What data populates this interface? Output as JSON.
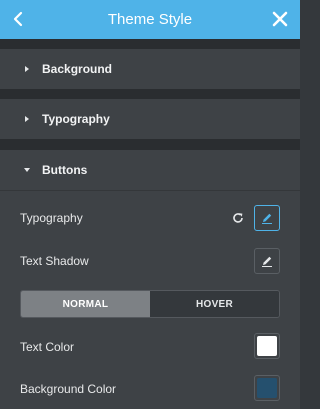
{
  "header": {
    "title": "Theme Style",
    "color": "#4fb3e8"
  },
  "sections": [
    {
      "label": "Background",
      "expanded": false
    },
    {
      "label": "Typography",
      "expanded": false
    },
    {
      "label": "Buttons",
      "expanded": true
    }
  ],
  "buttons_panel": {
    "typography_label": "Typography",
    "text_shadow_label": "Text Shadow",
    "tabs": [
      {
        "label": "NORMAL",
        "active": true
      },
      {
        "label": "HOVER",
        "active": false
      }
    ],
    "text_color_label": "Text Color",
    "text_color_value": "#ffffff",
    "background_color_label": "Background Color",
    "background_color_value": "#25506e"
  }
}
